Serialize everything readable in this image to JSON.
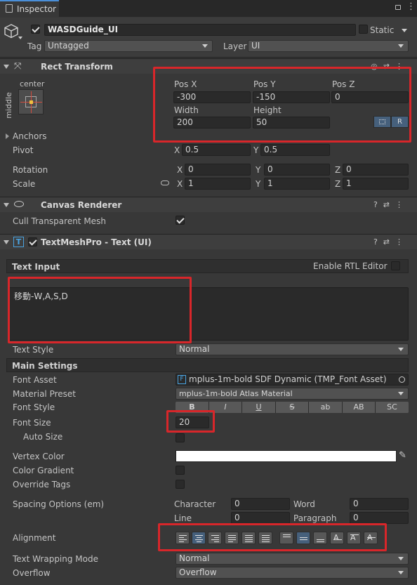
{
  "tab": {
    "title": "Inspector"
  },
  "gameobject": {
    "active": true,
    "name": "WASDGuide_UI",
    "static_label": "Static",
    "tag_label": "Tag",
    "tag": "Untagged",
    "layer_label": "Layer",
    "layer": "UI"
  },
  "rect_transform": {
    "title": "Rect Transform",
    "anchor_h": "center",
    "anchor_v": "middle",
    "posx_label": "Pos X",
    "posy_label": "Pos Y",
    "posz_label": "Pos Z",
    "posx": "-300",
    "posy": "-150",
    "posz": "0",
    "width_label": "Width",
    "height_label": "Height",
    "width": "200",
    "height": "50",
    "r_button": "R",
    "anchors_label": "Anchors",
    "pivot_label": "Pivot",
    "pivot_x": "0.5",
    "pivot_y": "0.5",
    "rotation_label": "Rotation",
    "rot_x": "0",
    "rot_y": "0",
    "rot_z": "0",
    "scale_label": "Scale",
    "scale_x": "1",
    "scale_y": "1",
    "scale_z": "1",
    "x": "X",
    "y": "Y",
    "z": "Z"
  },
  "canvas_renderer": {
    "title": "Canvas Renderer",
    "cull_label": "Cull Transparent Mesh",
    "cull": true
  },
  "tmp": {
    "title": "TextMeshPro - Text (UI)",
    "enabled": true,
    "text_input_label": "Text Input",
    "rtl_label": "Enable RTL Editor",
    "text": "移動-W,A,S,D",
    "text_style_label": "Text Style",
    "text_style": "Normal",
    "main_settings": "Main Settings",
    "font_asset_label": "Font Asset",
    "font_asset": "mplus-1m-bold SDF Dynamic (TMP_Font Asset)",
    "material_label": "Material Preset",
    "material": "mplus-1m-bold Atlas Material",
    "font_style_label": "Font Style",
    "styles": [
      "B",
      "I",
      "U",
      "S",
      "ab",
      "AB",
      "SC"
    ],
    "font_size_label": "Font Size",
    "font_size": "20",
    "auto_size_label": "Auto Size",
    "vertex_color_label": "Vertex Color",
    "vertex_color": "#ffffff",
    "color_gradient_label": "Color Gradient",
    "override_tags_label": "Override Tags",
    "spacing_label": "Spacing Options (em)",
    "character_label": "Character",
    "character": "0",
    "word_label": "Word",
    "word": "0",
    "line_label": "Line",
    "line": "0",
    "paragraph_label": "Paragraph",
    "paragraph": "0",
    "alignment_label": "Alignment",
    "wrapping_label": "Text Wrapping Mode",
    "wrapping": "Normal",
    "overflow_label": "Overflow",
    "overflow": "Overflow"
  }
}
